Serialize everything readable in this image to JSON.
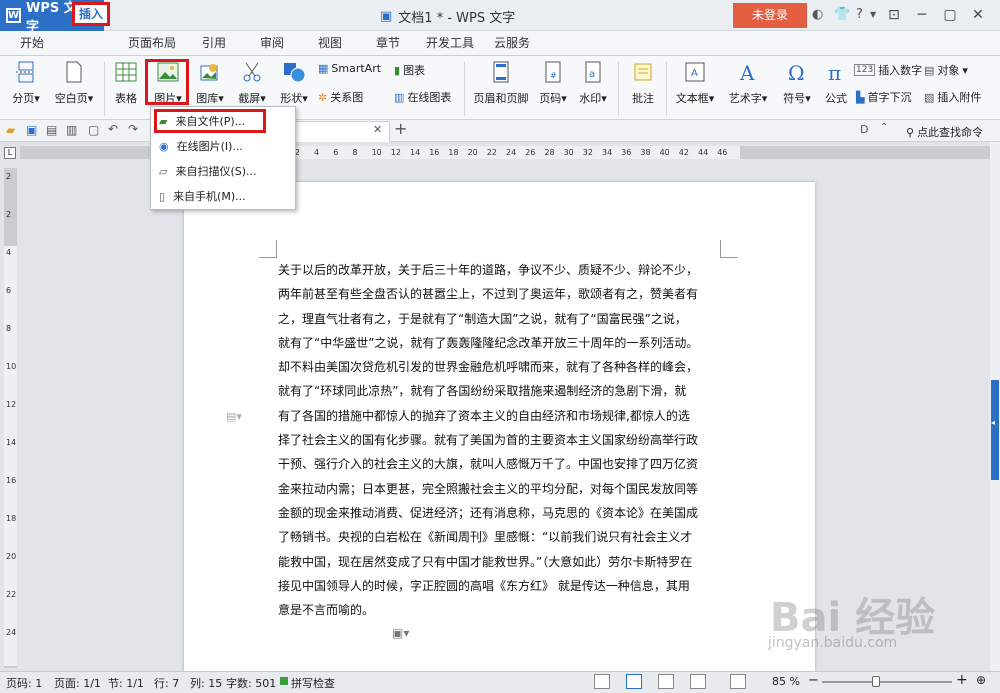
{
  "app": {
    "name": "WPS 文字",
    "doc_title": "文档1 * - WPS 文字",
    "login": "未登录"
  },
  "tabs": [
    "开始",
    "插入",
    "页面布局",
    "引用",
    "审阅",
    "视图",
    "章节",
    "开发工具",
    "云服务"
  ],
  "ribbon": {
    "fenye": "分页",
    "kongbaiye": "空白页",
    "biaoge": "表格",
    "tupian": "图片",
    "tuku": "图库",
    "jieping": "截屏",
    "xingzhuang": "形状",
    "smartart": "SmartArt",
    "tubiao": "图表",
    "guanxitu": "关系图",
    "zaixiantubiao": "在线图表",
    "yemeiyejiao": "页眉和页脚",
    "yema": "页码",
    "shuiyin": "水印",
    "pizhu": "批注",
    "wenbenkuang": "文本框",
    "yishuzi": "艺术字",
    "fuhao": "符号",
    "gongshi": "公式",
    "charushuzi": "插入数字",
    "duixiang": "对象",
    "shouzixiachen": "首字下沉",
    "charufujian": "插入附件"
  },
  "quickbar": {
    "find_command": "点此查找命令"
  },
  "menu": {
    "items": [
      "来自文件(P)...",
      "在线图片(I)...",
      "来自扫描仪(S)...",
      "来自手机(M)..."
    ]
  },
  "ruler_h": [
    "8",
    "6",
    "4",
    "2",
    "2",
    "4",
    "6",
    "8",
    "10",
    "12",
    "14",
    "16",
    "18",
    "20",
    "22",
    "24",
    "26",
    "28",
    "30",
    "32",
    "34",
    "36",
    "38",
    "40",
    "42",
    "44",
    "46"
  ],
  "ruler_v": [
    "2",
    "2",
    "4",
    "6",
    "8",
    "10",
    "12",
    "14",
    "16",
    "18",
    "20",
    "22",
    "24"
  ],
  "document": {
    "lines": [
      "关于以后的改革开放，关于后三十年的道路，争议不少、质疑不少、辩论不少，",
      "两年前甚至有些全盘否认的甚嚣尘上，不过到了奥运年，歌颂者有之，赞美者有",
      "之，理直气壮者有之，于是就有了“制造大国”之说，就有了“国富民强”之说，",
      "就有了“中华盛世”之说，就有了轰轰隆隆纪念改革开放三十周年的一系列活动。",
      "却不料由美国次贷危机引发的世界金融危机呼啸而来，就有了各种各样的峰会，",
      "就有了“环球同此凉热”，就有了各国纷纷采取措施来遏制经济的急剧下滑，就",
      "有了各国的措施中都惊人的抛弃了资本主义的自由经济和市场规律,都惊人的选",
      "择了社会主义的国有化步骤。就有了美国为首的主要资本主义国家纷纷高举行政",
      "干预、强行介入的社会主义的大旗，就叫人感慨万千了。中国也安排了四万亿资",
      "金来拉动内需；日本更甚，完全照搬社会主义的平均分配，对每个国民发放同等",
      "金额的现金来推动消费、促进经济；还有消息称，马克思的《资本论》在美国成",
      "了畅销书。央视的白岩松在《新闻周刊》里感慨：“以前我们说只有社会主义才",
      "能救中国，现在居然变成了只有中国才能救世界。”（大意如此）劳尔卡斯特罗在",
      "接见中国领导人的时候，字正腔圆的高唱《东方红》 就是传达一种信息，其用",
      "意是不言而喻的。"
    ]
  },
  "status": {
    "page_code": "页码: 1",
    "page": "页面: 1/1",
    "section": "节: 1/1",
    "row": "行: 7",
    "col": "列: 15",
    "words": "字数: 501",
    "spell": "拼写检查",
    "zoom": "85 %"
  },
  "watermark": {
    "main": "Bai 经验",
    "sub": "jingyan.baidu.com"
  },
  "colors": {
    "accent": "#2b6fc7",
    "highlight": "#d9181b",
    "login": "#e45e42"
  }
}
